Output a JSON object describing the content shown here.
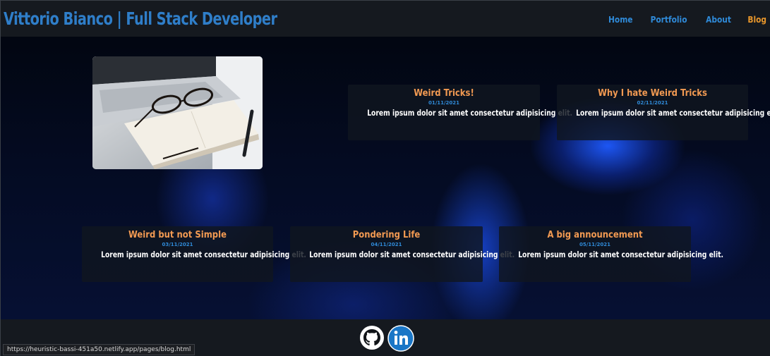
{
  "header": {
    "title": "Vittorio Bianco | Full Stack Developer",
    "nav": [
      "Home",
      "Portfolio",
      "About",
      "Blog"
    ],
    "active_nav": "Blog"
  },
  "hero_image": {
    "alt": "laptop-glasses-notebook-photo"
  },
  "posts": [
    {
      "title": "Weird Tricks!",
      "date": "01/11/2021",
      "excerpt": "Lorem ipsum dolor sit amet consectetur adipisicing elit."
    },
    {
      "title": "Why I hate Weird Tricks",
      "date": "02/11/2021",
      "excerpt": "Lorem ipsum dolor sit amet consectetur adipisicing elit."
    },
    {
      "title": "Weird but not Simple",
      "date": "03/11/2021",
      "excerpt": "Lorem ipsum dolor sit amet consectetur adipisicing elit."
    },
    {
      "title": "Pondering Life",
      "date": "04/11/2021",
      "excerpt": "Lorem ipsum dolor sit amet consectetur adipisicing elit."
    },
    {
      "title": "A big announcement",
      "date": "05/11/2021",
      "excerpt": "Lorem ipsum dolor sit amet consectetur adipisicing elit."
    }
  ],
  "footer": {
    "icons": [
      "github-icon",
      "linkedin-icon"
    ]
  },
  "status_bar": {
    "url": "https://heuristic-bassi-451a50.netlify.app/pages/blog.html"
  },
  "colors": {
    "brand": "#2f7ec9",
    "nav": "#2f8ad8",
    "active": "#e8962b",
    "post_title": "#f29a52"
  }
}
